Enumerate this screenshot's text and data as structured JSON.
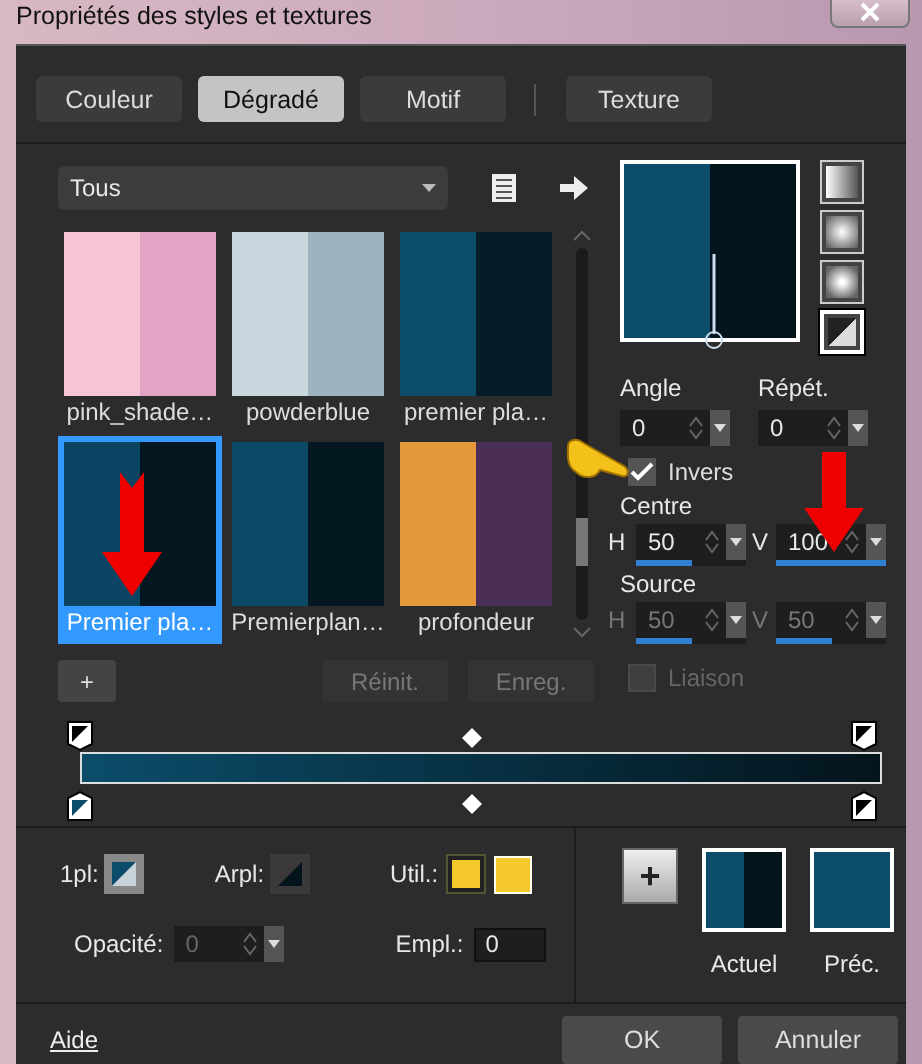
{
  "window": {
    "title": "Propriétés des styles et textures"
  },
  "tabs": [
    {
      "label": "Couleur",
      "selected": false
    },
    {
      "label": "Dégradé",
      "selected": true
    },
    {
      "label": "Motif",
      "selected": false
    },
    {
      "label": "Texture",
      "selected": false
    }
  ],
  "gallery": {
    "filter": "Tous",
    "items": [
      {
        "label": "pink_shade…",
        "selected": false,
        "stops": [
          {
            "color": "#f7c6d6"
          },
          {
            "color": "#e3a3c4"
          }
        ]
      },
      {
        "label": "powderblue",
        "selected": false,
        "stops": [
          {
            "color": "#c9d8de"
          },
          {
            "color": "#9db3bd"
          }
        ]
      },
      {
        "label": "premier pla…",
        "selected": false,
        "stops": [
          {
            "color": "#0c4d69"
          },
          {
            "color": "#061c29"
          }
        ]
      },
      {
        "label": "Premier pla…",
        "selected": true,
        "stops": [
          {
            "color": "#0b4563"
          },
          {
            "color": "#04161f"
          }
        ]
      },
      {
        "label": "Premierplan…",
        "selected": false,
        "stops": [
          {
            "color": "#0b4a66"
          },
          {
            "color": "#041822"
          }
        ]
      },
      {
        "label": "profondeur",
        "selected": false,
        "stops": [
          {
            "color": "#e49a3a"
          },
          {
            "color": "#4b2e55"
          }
        ]
      }
    ]
  },
  "styles": [
    {
      "kind": "linear",
      "selected": false
    },
    {
      "kind": "rectangular",
      "selected": false
    },
    {
      "kind": "sunburst",
      "selected": false
    },
    {
      "kind": "radial",
      "selected": true
    }
  ],
  "gradient": {
    "stops": [
      {
        "color": "#0b4d6a"
      },
      {
        "color": "#04141c"
      }
    ]
  },
  "angle": {
    "label": "Angle",
    "value": "0"
  },
  "repeats": {
    "label": "Répét.",
    "value": "0"
  },
  "invert": {
    "label": "Invers",
    "checked": true
  },
  "centre": {
    "label": "Centre",
    "h": {
      "label": "H",
      "value": "50",
      "level": 0.5
    },
    "v": {
      "label": "V",
      "value": "100",
      "level": 1
    }
  },
  "source": {
    "label": "Source",
    "disabled": true,
    "h": {
      "label": "H",
      "value": "50",
      "level": 0.5
    },
    "v": {
      "label": "V",
      "value": "50",
      "level": 0.5
    }
  },
  "link": {
    "label": "Liaison",
    "checked": false,
    "disabled": true
  },
  "actions": [
    {
      "label": "+",
      "disabled": false
    },
    {
      "label": "Réinit.",
      "disabled": true
    },
    {
      "label": "Enreg.",
      "disabled": true
    }
  ],
  "foreground": {
    "label": "1pl:"
  },
  "background": {
    "label": "Arpl:"
  },
  "user": {
    "label": "Util.:"
  },
  "opacity": {
    "label": "Opacité:",
    "value": "0",
    "disabled": true
  },
  "location": {
    "label": "Empl.:",
    "value": "0"
  },
  "add_button": "+",
  "current": {
    "label": "Actuel"
  },
  "previous": {
    "label": "Préc.",
    "color": "#0b4d6a"
  },
  "footer": {
    "help": "Aide",
    "ok": "OK",
    "cancel": "Annuler"
  }
}
